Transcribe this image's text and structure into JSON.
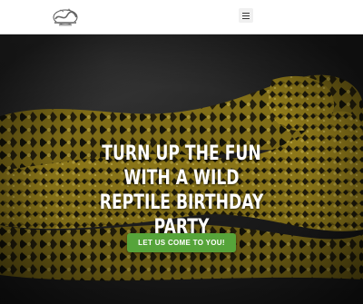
{
  "header": {
    "logo_icon": "reptile-logo-icon",
    "menu_icon": "hamburger-menu-icon"
  },
  "hero": {
    "headline": "TURN UP THE FUN WITH A WILD REPTILE BIRTHDAY PARTY",
    "cta_label": "LET US COME TO YOU!",
    "colors": {
      "cta_background": "#56a43a",
      "headline_text": "#ffffff",
      "snake_yellow": "#b49a22",
      "snake_dark": "#1b1a0c"
    }
  }
}
